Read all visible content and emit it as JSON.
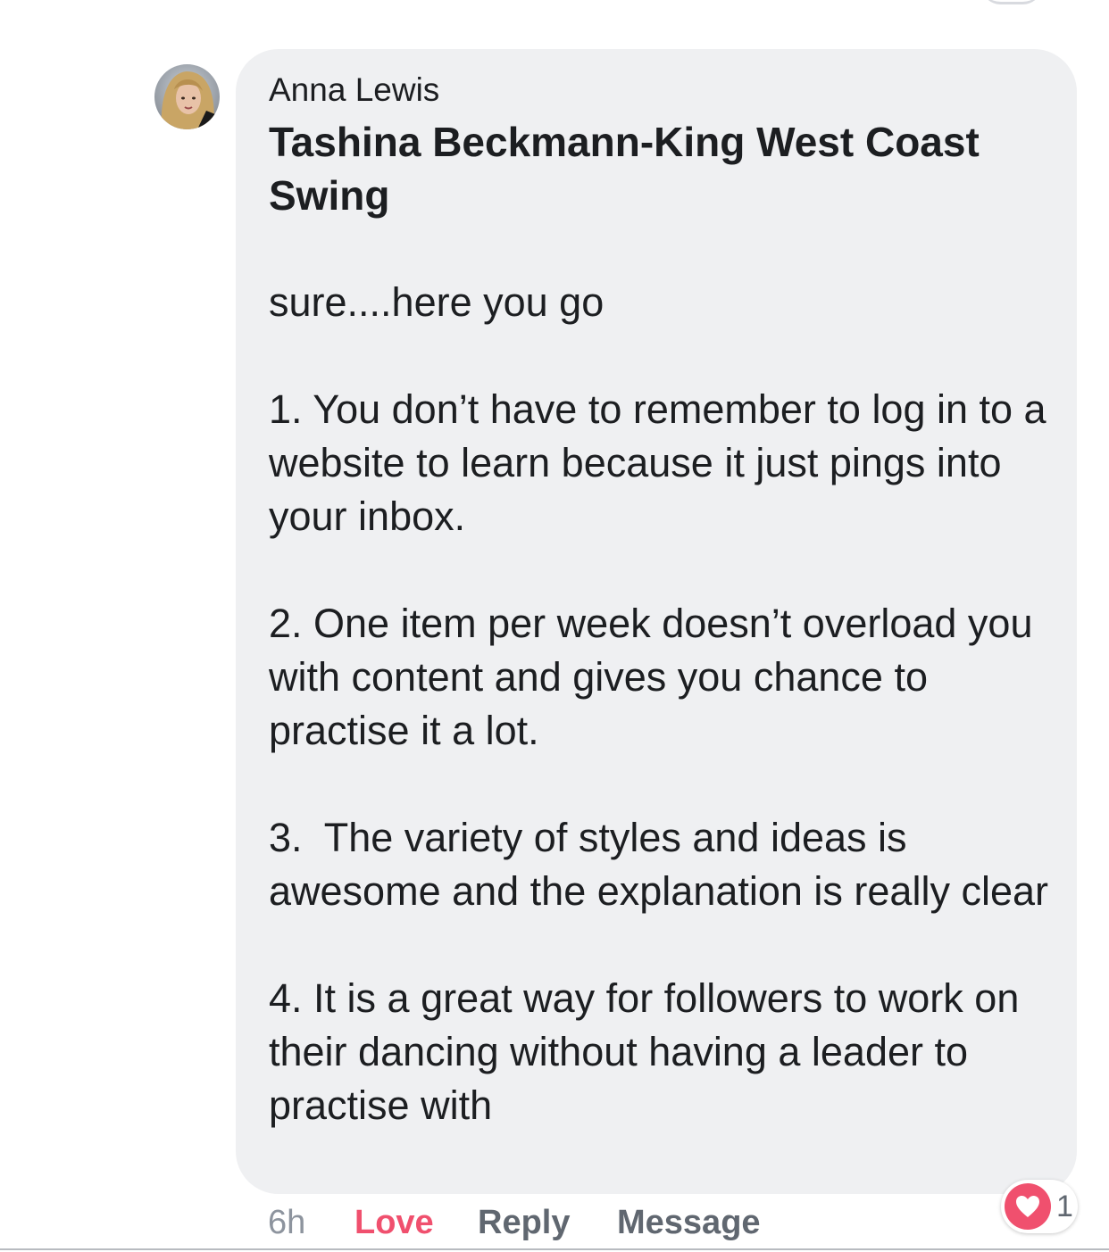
{
  "comment": {
    "author": "Anna Lewis",
    "mention": "Tashina Beckmann-King West Coast Swing",
    "paragraphs": [
      "sure....here you go",
      "1. You don’t have to remember to log in to a website to learn because it just pings into your inbox.",
      "2. One item per week doesn’t overload you with content and gives you chance to practise it a lot.",
      "3.  The variety of styles and ideas is awesome and the explanation is really clear",
      "4. It is a great way for followers to work on their dancing without having a leader to practise with"
    ],
    "actions": {
      "time": "6h",
      "love": "Love",
      "reply": "Reply",
      "message": "Message"
    },
    "reaction": {
      "icon": "heart-icon",
      "count": "1",
      "color": "#f0506e"
    }
  },
  "colors": {
    "bubble": "#eff0f2",
    "text": "#1c1e21",
    "love_active": "#f0506e",
    "muted": "#606770"
  }
}
